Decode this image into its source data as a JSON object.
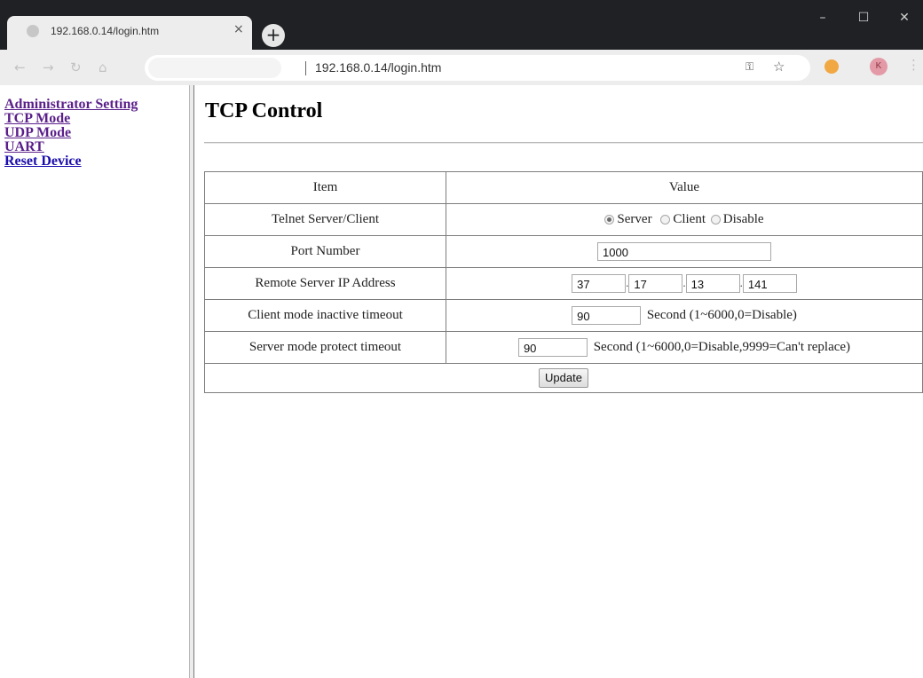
{
  "browser": {
    "tab_title": "192.168.0.14/login.htm",
    "url": "192.168.0.14/login.htm",
    "profile_initial": "K",
    "icons": {
      "favicon": "globe-icon",
      "tab_close": "close-icon",
      "new_tab": "plus-icon",
      "back": "back-arrow-icon",
      "forward": "forward-arrow-icon",
      "reload": "reload-icon",
      "home": "home-icon",
      "key": "key-icon",
      "bookmark": "star-icon",
      "extension": "extension-icon",
      "menu": "kebab-menu-icon",
      "minimize": "minimize-icon",
      "maximize": "maximize-icon",
      "close": "window-close-icon"
    },
    "glyphs": {
      "tab_close": "×",
      "new_tab": "+",
      "back": "←",
      "forward": "→",
      "reload": "↻",
      "home": "⌂",
      "key": "⚿",
      "star": "☆",
      "menu": "⋮",
      "minimize": "–",
      "maximize": "☐",
      "close": "✕"
    }
  },
  "sidebar": {
    "links": [
      "Administrator Setting",
      "TCP Mode",
      "UDP Mode",
      "UART",
      "Reset Device"
    ]
  },
  "page": {
    "title": "TCP Control",
    "table": {
      "headers": [
        "Item",
        "Value"
      ],
      "rows": [
        {
          "label": "Telnet Server/Client",
          "options": [
            "Server",
            "Client",
            "Disable"
          ],
          "selected": "Server"
        },
        {
          "label": "Port Number",
          "value": "1000"
        },
        {
          "label": "Remote Server IP Address",
          "octets": [
            "37",
            "17",
            "13",
            "141"
          ],
          "separator": "."
        },
        {
          "label": "Client mode inactive timeout",
          "value": "90",
          "unit": "Second (1~6000,0=Disable)"
        },
        {
          "label": "Server mode protect timeout",
          "value": "90",
          "unit": "Second (1~6000,0=Disable,9999=Can't replace)"
        }
      ],
      "button": "Update"
    }
  },
  "colors": {
    "titlebar": "#202124",
    "toolbar": "#ededed",
    "visited_link": "#5a1f8a",
    "link": "#1a0dab"
  }
}
